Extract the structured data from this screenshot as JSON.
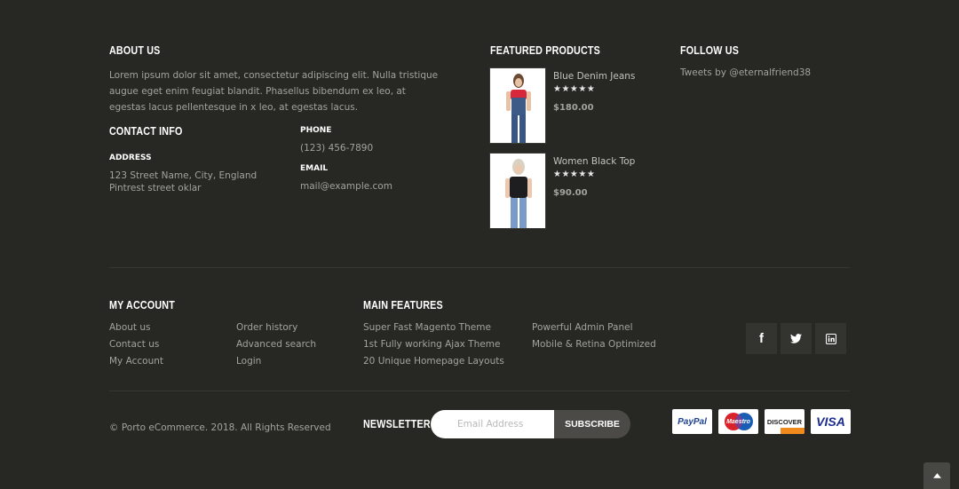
{
  "about": {
    "heading": "ABOUT US",
    "lines": [
      "Lorem ipsum dolor sit amet, consectetur adipiscing elit. Nulla tristique",
      "augue eget enim feugiat blandit. Phasellus bibendum ex leo, at",
      "egestas lacus pellentesque in x leo, at egestas lacus."
    ]
  },
  "contact": {
    "heading": "CONTACT INFO",
    "address_label": "ADDRESS",
    "address_lines": [
      "123 Street Name, City, England",
      "Pintrest street oklar"
    ],
    "phone_label": "PHONE",
    "phone": "(123) 456-7890",
    "email_label": "EMAIL",
    "email": "mail@example.com"
  },
  "featured": {
    "heading": "FEATURED PRODUCTS",
    "products": [
      {
        "name": "Blue Denim Jeans",
        "rating": 5,
        "stars": "★★★★★",
        "price": "$180.00"
      },
      {
        "name": "Women Black Top",
        "rating": 5,
        "stars": "★★★★★",
        "price": "$90.00"
      }
    ]
  },
  "follow": {
    "heading": "FOLLOW US",
    "tweets": "Tweets by @eternalfriend38"
  },
  "account": {
    "heading": "MY ACCOUNT",
    "col1": [
      "About us",
      "Contact us",
      "My Account"
    ],
    "col2": [
      "Order history",
      "Advanced search",
      "Login"
    ]
  },
  "features": {
    "heading": "MAIN FEATURES",
    "col1": [
      "Super Fast Magento Theme",
      "1st Fully working Ajax Theme",
      "20 Unique Homepage Layouts"
    ],
    "col2": [
      "Powerful Admin Panel",
      "Mobile & Retina Optimized"
    ]
  },
  "social": {
    "icons": [
      "facebook-icon",
      "twitter-icon",
      "linkedin-icon"
    ],
    "facebook": "f"
  },
  "bottom": {
    "copyright": "© Porto eCommerce. 2018. All Rights Reserved",
    "newsletter_label": "NEWSLETTER",
    "email_placeholder": "Email Address",
    "subscribe_label": "SUBSCRIBE",
    "payments": {
      "paypal": "PayPal",
      "maestro": "Maestro",
      "discover": "DISCOVER",
      "visa": "VISA"
    }
  },
  "colors": {
    "background": "#272723",
    "heading": "#ffffff",
    "text": "#a3a39e",
    "social_bg": "#33332f"
  }
}
